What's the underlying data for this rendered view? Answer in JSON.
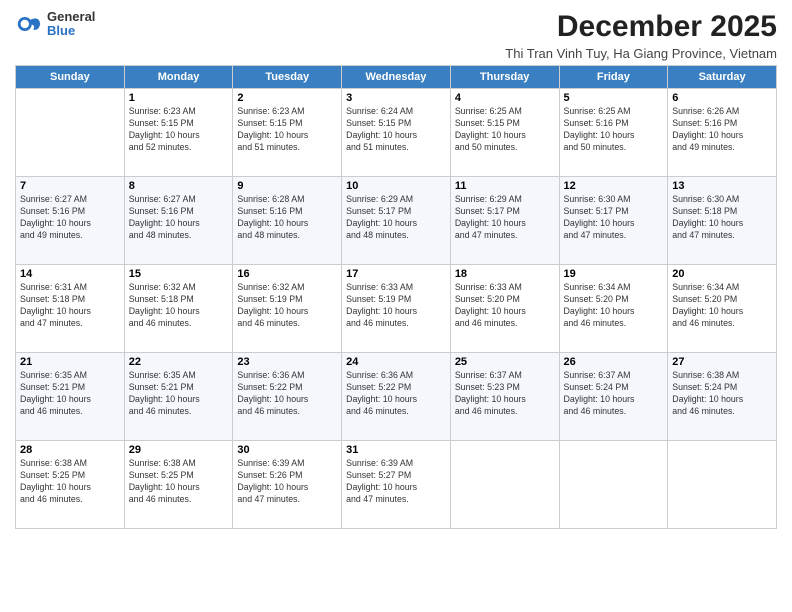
{
  "logo": {
    "general": "General",
    "blue": "Blue"
  },
  "title": "December 2025",
  "subtitle": "Thi Tran Vinh Tuy, Ha Giang Province, Vietnam",
  "days_of_week": [
    "Sunday",
    "Monday",
    "Tuesday",
    "Wednesday",
    "Thursday",
    "Friday",
    "Saturday"
  ],
  "weeks": [
    [
      {
        "day": "",
        "info": ""
      },
      {
        "day": "1",
        "info": "Sunrise: 6:23 AM\nSunset: 5:15 PM\nDaylight: 10 hours\nand 52 minutes."
      },
      {
        "day": "2",
        "info": "Sunrise: 6:23 AM\nSunset: 5:15 PM\nDaylight: 10 hours\nand 51 minutes."
      },
      {
        "day": "3",
        "info": "Sunrise: 6:24 AM\nSunset: 5:15 PM\nDaylight: 10 hours\nand 51 minutes."
      },
      {
        "day": "4",
        "info": "Sunrise: 6:25 AM\nSunset: 5:15 PM\nDaylight: 10 hours\nand 50 minutes."
      },
      {
        "day": "5",
        "info": "Sunrise: 6:25 AM\nSunset: 5:16 PM\nDaylight: 10 hours\nand 50 minutes."
      },
      {
        "day": "6",
        "info": "Sunrise: 6:26 AM\nSunset: 5:16 PM\nDaylight: 10 hours\nand 49 minutes."
      }
    ],
    [
      {
        "day": "7",
        "info": "Sunrise: 6:27 AM\nSunset: 5:16 PM\nDaylight: 10 hours\nand 49 minutes."
      },
      {
        "day": "8",
        "info": "Sunrise: 6:27 AM\nSunset: 5:16 PM\nDaylight: 10 hours\nand 48 minutes."
      },
      {
        "day": "9",
        "info": "Sunrise: 6:28 AM\nSunset: 5:16 PM\nDaylight: 10 hours\nand 48 minutes."
      },
      {
        "day": "10",
        "info": "Sunrise: 6:29 AM\nSunset: 5:17 PM\nDaylight: 10 hours\nand 48 minutes."
      },
      {
        "day": "11",
        "info": "Sunrise: 6:29 AM\nSunset: 5:17 PM\nDaylight: 10 hours\nand 47 minutes."
      },
      {
        "day": "12",
        "info": "Sunrise: 6:30 AM\nSunset: 5:17 PM\nDaylight: 10 hours\nand 47 minutes."
      },
      {
        "day": "13",
        "info": "Sunrise: 6:30 AM\nSunset: 5:18 PM\nDaylight: 10 hours\nand 47 minutes."
      }
    ],
    [
      {
        "day": "14",
        "info": "Sunrise: 6:31 AM\nSunset: 5:18 PM\nDaylight: 10 hours\nand 47 minutes."
      },
      {
        "day": "15",
        "info": "Sunrise: 6:32 AM\nSunset: 5:18 PM\nDaylight: 10 hours\nand 46 minutes."
      },
      {
        "day": "16",
        "info": "Sunrise: 6:32 AM\nSunset: 5:19 PM\nDaylight: 10 hours\nand 46 minutes."
      },
      {
        "day": "17",
        "info": "Sunrise: 6:33 AM\nSunset: 5:19 PM\nDaylight: 10 hours\nand 46 minutes."
      },
      {
        "day": "18",
        "info": "Sunrise: 6:33 AM\nSunset: 5:20 PM\nDaylight: 10 hours\nand 46 minutes."
      },
      {
        "day": "19",
        "info": "Sunrise: 6:34 AM\nSunset: 5:20 PM\nDaylight: 10 hours\nand 46 minutes."
      },
      {
        "day": "20",
        "info": "Sunrise: 6:34 AM\nSunset: 5:20 PM\nDaylight: 10 hours\nand 46 minutes."
      }
    ],
    [
      {
        "day": "21",
        "info": "Sunrise: 6:35 AM\nSunset: 5:21 PM\nDaylight: 10 hours\nand 46 minutes."
      },
      {
        "day": "22",
        "info": "Sunrise: 6:35 AM\nSunset: 5:21 PM\nDaylight: 10 hours\nand 46 minutes."
      },
      {
        "day": "23",
        "info": "Sunrise: 6:36 AM\nSunset: 5:22 PM\nDaylight: 10 hours\nand 46 minutes."
      },
      {
        "day": "24",
        "info": "Sunrise: 6:36 AM\nSunset: 5:22 PM\nDaylight: 10 hours\nand 46 minutes."
      },
      {
        "day": "25",
        "info": "Sunrise: 6:37 AM\nSunset: 5:23 PM\nDaylight: 10 hours\nand 46 minutes."
      },
      {
        "day": "26",
        "info": "Sunrise: 6:37 AM\nSunset: 5:24 PM\nDaylight: 10 hours\nand 46 minutes."
      },
      {
        "day": "27",
        "info": "Sunrise: 6:38 AM\nSunset: 5:24 PM\nDaylight: 10 hours\nand 46 minutes."
      }
    ],
    [
      {
        "day": "28",
        "info": "Sunrise: 6:38 AM\nSunset: 5:25 PM\nDaylight: 10 hours\nand 46 minutes."
      },
      {
        "day": "29",
        "info": "Sunrise: 6:38 AM\nSunset: 5:25 PM\nDaylight: 10 hours\nand 46 minutes."
      },
      {
        "day": "30",
        "info": "Sunrise: 6:39 AM\nSunset: 5:26 PM\nDaylight: 10 hours\nand 47 minutes."
      },
      {
        "day": "31",
        "info": "Sunrise: 6:39 AM\nSunset: 5:27 PM\nDaylight: 10 hours\nand 47 minutes."
      },
      {
        "day": "",
        "info": ""
      },
      {
        "day": "",
        "info": ""
      },
      {
        "day": "",
        "info": ""
      }
    ]
  ]
}
